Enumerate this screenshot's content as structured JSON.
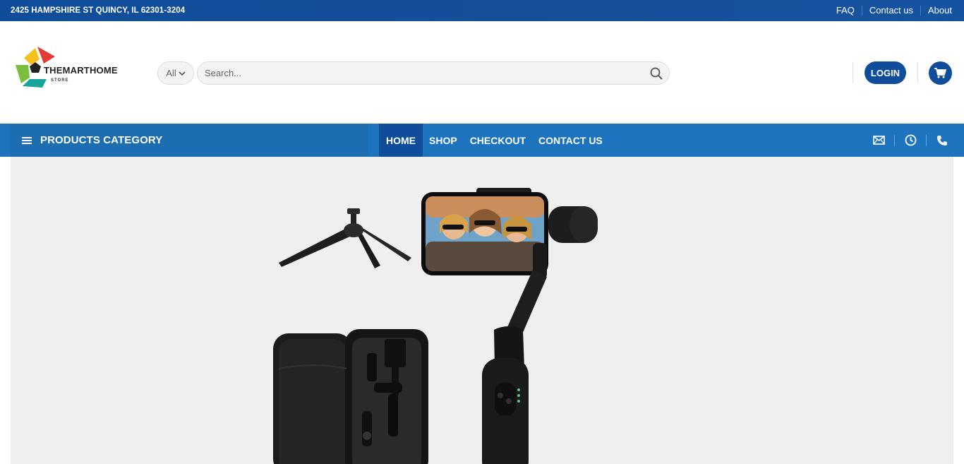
{
  "topbar": {
    "address": "2425 HAMPSHIRE ST QUINCY, IL 62301-3204",
    "links": [
      "FAQ",
      "Contact us",
      "About"
    ]
  },
  "header": {
    "logo_text": "THEMARTHOME",
    "logo_sub": "STORE",
    "search_category": "All",
    "search_placeholder": "Search...",
    "login_label": "LOGIN"
  },
  "nav": {
    "category_label": "PRODUCTS CATEGORY",
    "menu": [
      "HOME",
      "SHOP",
      "CHECKOUT",
      "CONTACT US"
    ]
  },
  "colors": {
    "primary": "#0f4d9a",
    "nav": "#1e73be",
    "hero_bg": "#efefef"
  }
}
